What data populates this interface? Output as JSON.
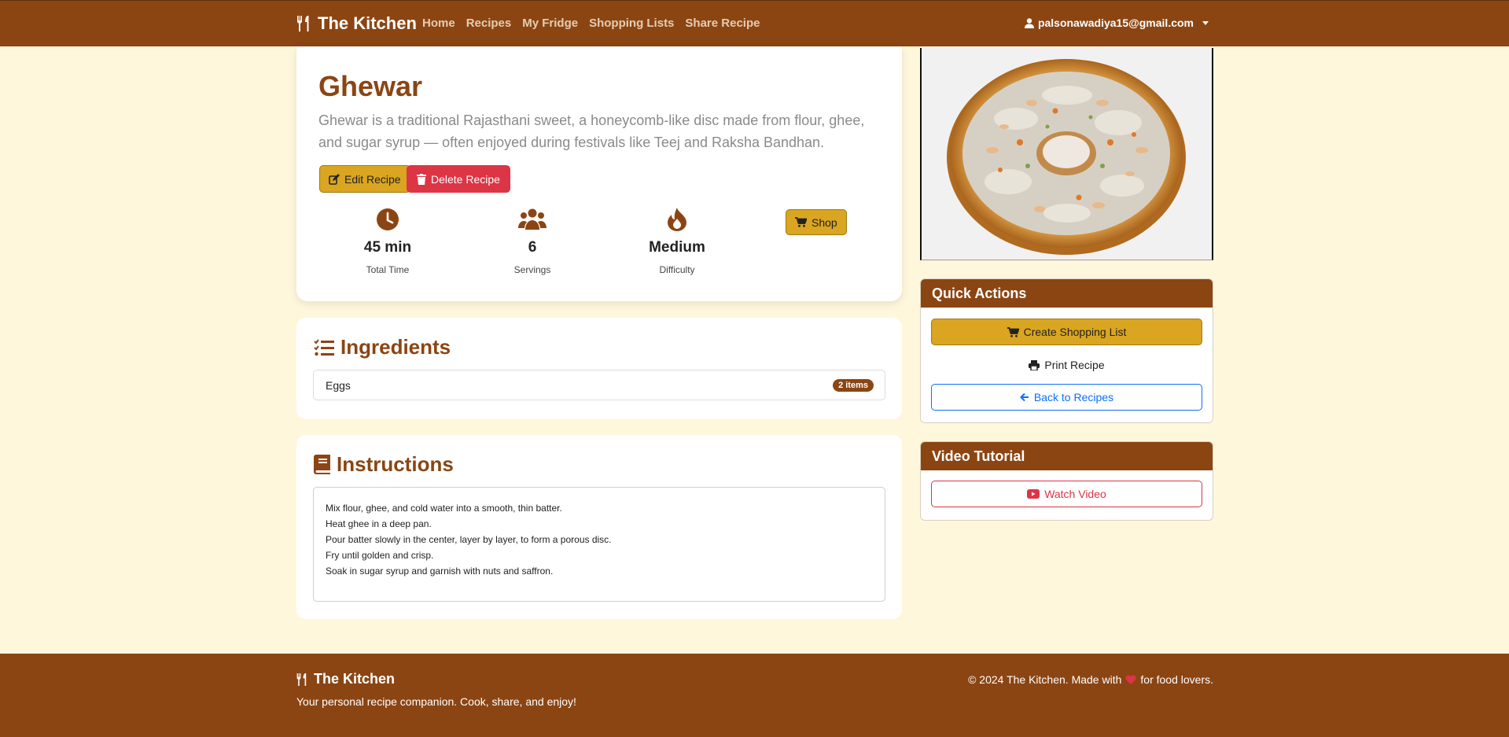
{
  "nav": {
    "brand": "The Kitchen",
    "links": [
      "Home",
      "Recipes",
      "My Fridge",
      "Shopping Lists",
      "Share Recipe"
    ],
    "user_email": "palsonawadiya15@gmail.com"
  },
  "recipe": {
    "title": "Ghewar",
    "description": "Ghewar is a traditional Rajasthani sweet, a honeycomb-like disc made from flour, ghee, and sugar syrup — often enjoyed during festivals like Teej and Raksha Bandhan.",
    "edit_label": "Edit Recipe",
    "delete_label": "Delete Recipe",
    "shop_label": "Shop",
    "stats": [
      {
        "value": "45 min",
        "label": "Total Time",
        "icon": "clock-icon"
      },
      {
        "value": "6",
        "label": "Servings",
        "icon": "users-icon"
      },
      {
        "value": "Medium",
        "label": "Difficulty",
        "icon": "fire-icon"
      }
    ]
  },
  "ingredients": {
    "heading": "Ingredients",
    "items": [
      {
        "name": "Eggs",
        "badge": "2 items"
      }
    ]
  },
  "instructions": {
    "heading": "Instructions",
    "steps": [
      "Mix flour, ghee, and cold water into a smooth, thin batter.",
      "Heat ghee in a deep pan.",
      "Pour batter slowly in the center, layer by layer, to form a porous disc.",
      "Fry until golden and crisp.",
      "Soak in sugar syrup and garnish with nuts and saffron."
    ]
  },
  "quick_actions": {
    "heading": "Quick Actions",
    "create_list": "Create Shopping List",
    "print": "Print Recipe",
    "back": "Back to Recipes"
  },
  "video": {
    "heading": "Video Tutorial",
    "watch": "Watch Video"
  },
  "footer": {
    "brand": "The Kitchen",
    "tagline": "Your personal recipe companion. Cook, share, and enjoy!",
    "copyright_prefix": "© 2024 The Kitchen. Made with",
    "copyright_suffix": "for food lovers."
  },
  "colors": {
    "brand_brown": "#8b4513",
    "gold": "#daa520",
    "danger": "#dc3545",
    "page_bg": "#fff7dc"
  }
}
